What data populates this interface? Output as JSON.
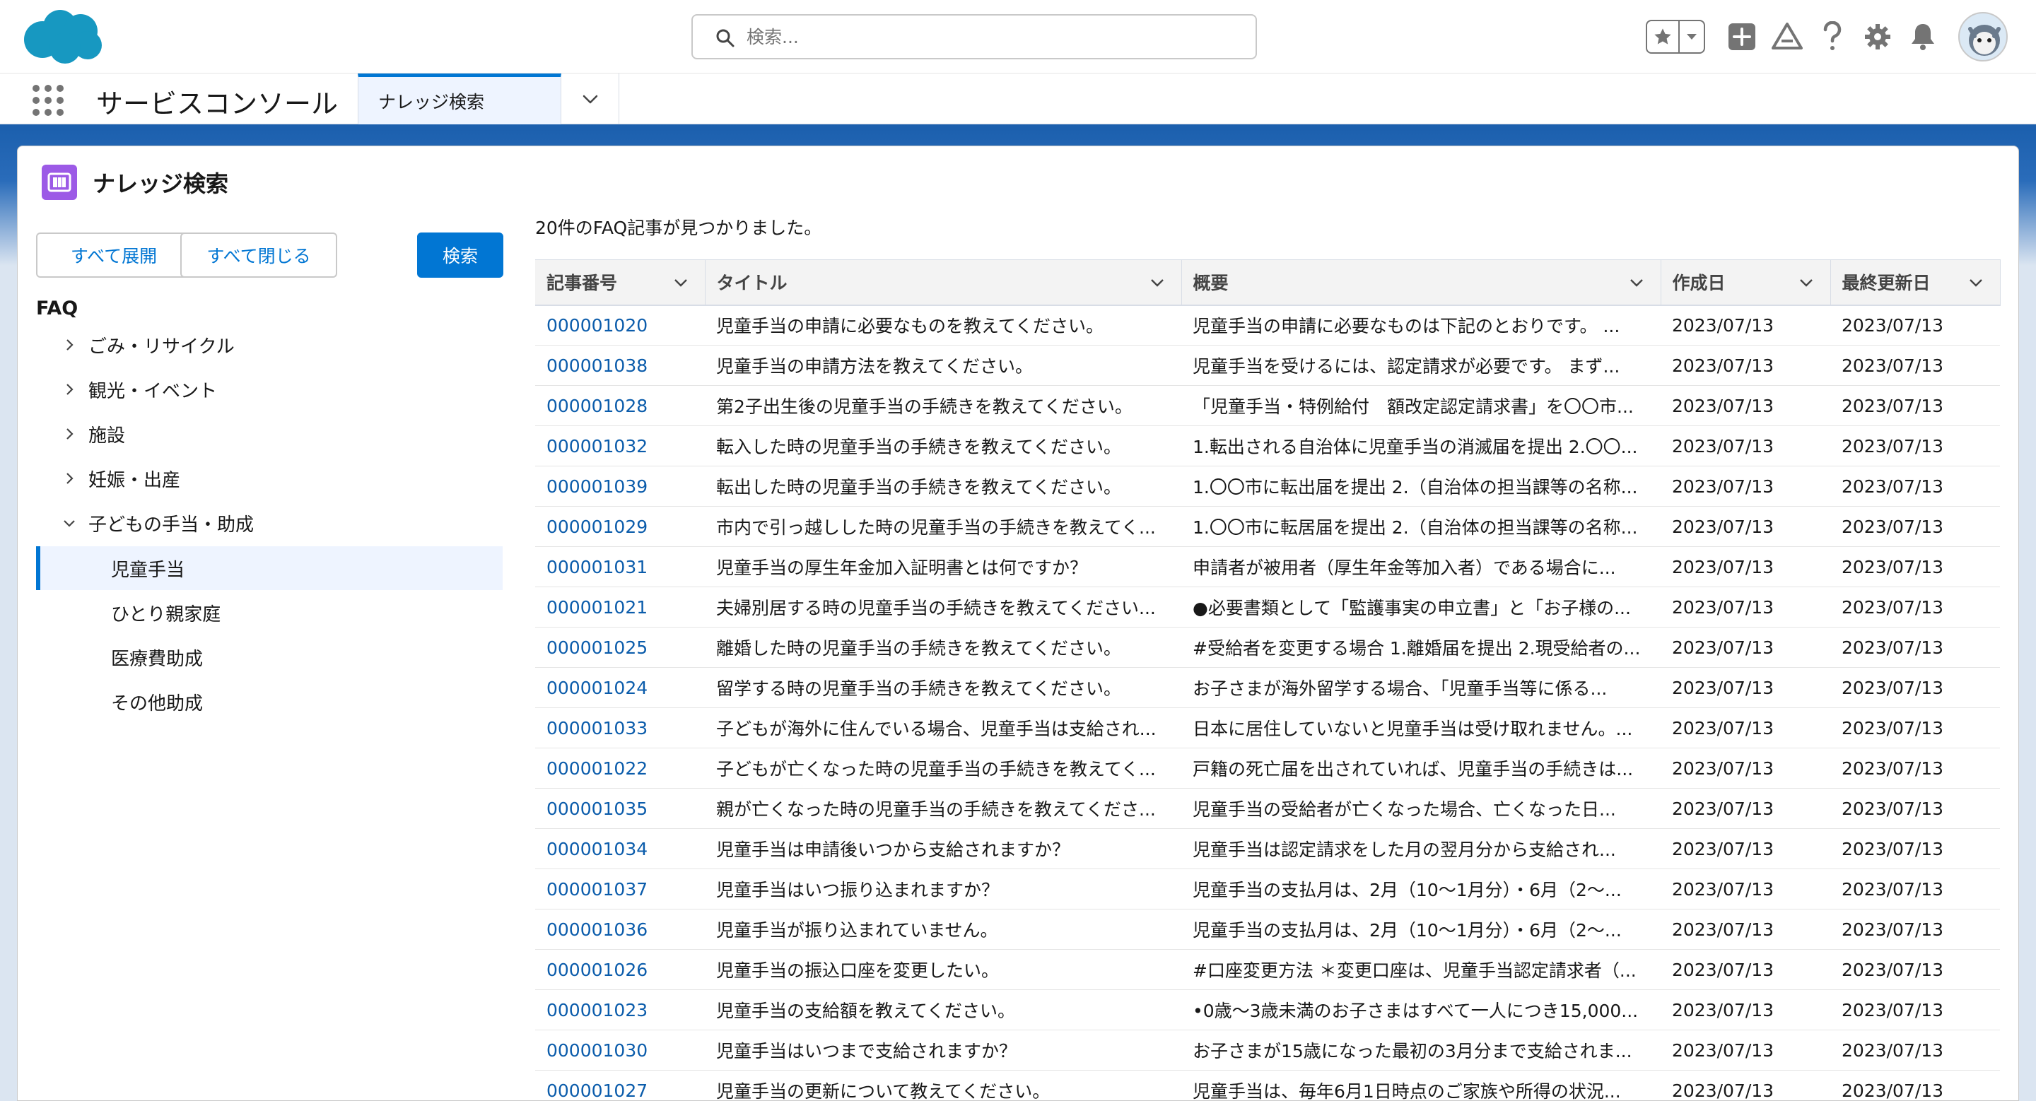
{
  "header": {
    "search_placeholder": "検索..."
  },
  "nav": {
    "app_name": "サービスコンソール",
    "active_tab": "ナレッジ検索"
  },
  "card": {
    "title": "ナレッジ検索",
    "expand_all": "すべて展開",
    "collapse_all": "すべて閉じる",
    "search_button": "検索",
    "result_count": "20件のFAQ記事が見つかりました。"
  },
  "tree": {
    "heading": "FAQ",
    "categories": [
      {
        "label": "ごみ・リサイクル",
        "state": "collapsed"
      },
      {
        "label": "観光・イベント",
        "state": "collapsed"
      },
      {
        "label": "施設",
        "state": "collapsed"
      },
      {
        "label": "妊娠・出産",
        "state": "collapsed"
      },
      {
        "label": "子どもの手当・助成",
        "state": "expanded"
      }
    ],
    "children": [
      {
        "label": "児童手当",
        "selected": true
      },
      {
        "label": "ひとり親家庭",
        "selected": false
      },
      {
        "label": "医療費助成",
        "selected": false
      },
      {
        "label": "その他助成",
        "selected": false
      }
    ]
  },
  "table": {
    "columns": [
      "記事番号",
      "タイトル",
      "概要",
      "作成日",
      "最終更新日"
    ],
    "rows": [
      [
        "000001020",
        "児童手当の申請に必要なものを教えてください。",
        "児童手当の申請に必要なものは下記のとおりです。 ...",
        "2023/07/13",
        "2023/07/13"
      ],
      [
        "000001038",
        "児童手当の申請方法を教えてください。",
        "児童手当を受けるには、認定請求が必要です。 まず...",
        "2023/07/13",
        "2023/07/13"
      ],
      [
        "000001028",
        "第2子出生後の児童手当の手続きを教えてください。",
        "「児童手当・特例給付　額改定認定請求書」を〇〇市...",
        "2023/07/13",
        "2023/07/13"
      ],
      [
        "000001032",
        "転入した時の児童手当の手続きを教えてください。",
        "1.転出される自治体に児童手当の消滅届を提出 2.〇〇...",
        "2023/07/13",
        "2023/07/13"
      ],
      [
        "000001039",
        "転出した時の児童手当の手続きを教えてください。",
        "1.〇〇市に転出届を提出 2.（自治体の担当課等の名称...",
        "2023/07/13",
        "2023/07/13"
      ],
      [
        "000001029",
        "市内で引っ越しした時の児童手当の手続きを教えてく...",
        "1.〇〇市に転居届を提出 2.（自治体の担当課等の名称...",
        "2023/07/13",
        "2023/07/13"
      ],
      [
        "000001031",
        "児童手当の厚生年金加入証明書とは何ですか？",
        "申請者が被用者（厚生年金等加入者）である場合に...",
        "2023/07/13",
        "2023/07/13"
      ],
      [
        "000001021",
        "夫婦別居する時の児童手当の手続きを教えてください...",
        "●必要書類として「監護事実の申立書」と「お子様の...",
        "2023/07/13",
        "2023/07/13"
      ],
      [
        "000001025",
        "離婚した時の児童手当の手続きを教えてください。",
        "#受給者を変更する場合 1.離婚届を提出 2.現受給者の...",
        "2023/07/13",
        "2023/07/13"
      ],
      [
        "000001024",
        "留学する時の児童手当の手続きを教えてください。",
        "お子さまが海外留学する場合、「児童手当等に係る...",
        "2023/07/13",
        "2023/07/13"
      ],
      [
        "000001033",
        "子どもが海外に住んでいる場合、児童手当は支給され...",
        "日本に居住していないと児童手当は受け取れません。...",
        "2023/07/13",
        "2023/07/13"
      ],
      [
        "000001022",
        "子どもが亡くなった時の児童手当の手続きを教えてく...",
        "戸籍の死亡届を出されていれば、児童手当の手続きは...",
        "2023/07/13",
        "2023/07/13"
      ],
      [
        "000001035",
        "親が亡くなった時の児童手当の手続きを教えてくださ...",
        "児童手当の受給者が亡くなった場合、亡くなった日...",
        "2023/07/13",
        "2023/07/13"
      ],
      [
        "000001034",
        "児童手当は申請後いつから支給されますか？",
        "児童手当は認定請求をした月の翌月分から支給され...",
        "2023/07/13",
        "2023/07/13"
      ],
      [
        "000001037",
        "児童手当はいつ振り込まれますか？",
        "児童手当の支払月は、2月（10〜1月分）・6月（2〜...",
        "2023/07/13",
        "2023/07/13"
      ],
      [
        "000001036",
        "児童手当が振り込まれていません。",
        "児童手当の支払月は、2月（10〜1月分）・6月（2〜...",
        "2023/07/13",
        "2023/07/13"
      ],
      [
        "000001026",
        "児童手当の振込口座を変更したい。",
        "#口座変更方法 ＊変更口座は、児童手当認定請求者（...",
        "2023/07/13",
        "2023/07/13"
      ],
      [
        "000001023",
        "児童手当の支給額を教えてください。",
        "•0歳〜3歳未満のお子さまはすべて一人につき15,000...",
        "2023/07/13",
        "2023/07/13"
      ],
      [
        "000001030",
        "児童手当はいつまで支給されますか？",
        "お子さまが15歳になった最初の3月分まで支給されま...",
        "2023/07/13",
        "2023/07/13"
      ],
      [
        "000001027",
        "児童手当の更新について教えてください。",
        "児童手当は、毎年6月1日時点のご家族や所得の状況...",
        "2023/07/13",
        "2023/07/13"
      ]
    ]
  },
  "colors": {
    "brand": "#0176d3",
    "link": "#0b5cab",
    "logo": "#1798c1",
    "knowledge_icon": "#9c5ae6"
  }
}
